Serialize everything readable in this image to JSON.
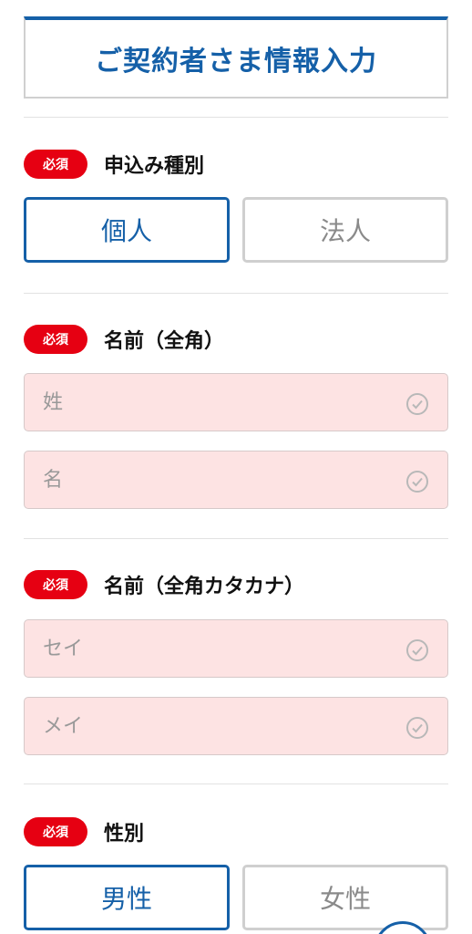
{
  "header": {
    "title": "ご契約者さま情報入力"
  },
  "required_badge": "必須",
  "sections": {
    "application_type": {
      "label": "申込み種別",
      "options": [
        "個人",
        "法人"
      ],
      "selected": "個人"
    },
    "name_kanji": {
      "label": "名前（全角）",
      "last_placeholder": "姓",
      "first_placeholder": "名"
    },
    "name_kana": {
      "label": "名前（全角カタカナ）",
      "last_placeholder": "セイ",
      "first_placeholder": "メイ"
    },
    "gender": {
      "label": "性別",
      "options": [
        "男性",
        "女性"
      ],
      "selected": "男性"
    }
  },
  "colors": {
    "brand": "#1560a8",
    "required": "#e60012",
    "input_error_bg": "#fde3e3"
  },
  "icons": {
    "input_status": "check-circle-icon"
  }
}
